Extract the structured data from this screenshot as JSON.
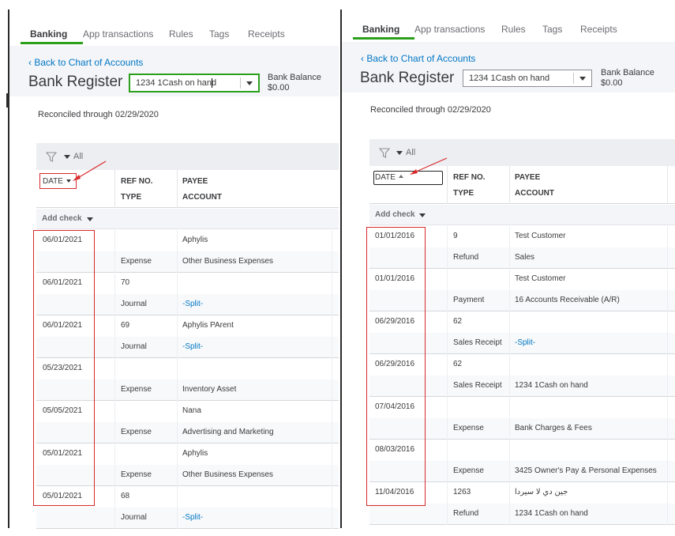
{
  "left": {
    "tabs": [
      "Banking",
      "App transactions",
      "Rules",
      "Tags",
      "Receipts"
    ],
    "back_link": "Back to Chart of Accounts",
    "title": "Bank Register",
    "account": "1234 1Cash on hand",
    "balance_label": "Bank Balance",
    "balance_value": "$0.00",
    "reconciled": "Reconciled through 02/29/2020",
    "filter_all": "All",
    "headers": {
      "date": "DATE",
      "ref": "REF NO.",
      "type": "TYPE",
      "payee": "PAYEE",
      "account": "ACCOUNT"
    },
    "add_check": "Add check",
    "rows": [
      {
        "date": "06/01/2021",
        "ref": "",
        "type": "Expense",
        "payee": "Aphylis",
        "account": "Other Business Expenses"
      },
      {
        "date": "06/01/2021",
        "ref": "70",
        "type": "Journal",
        "payee": "",
        "account": "-Split-"
      },
      {
        "date": "06/01/2021",
        "ref": "69",
        "type": "Journal",
        "payee": "Aphylis PArent",
        "account": "-Split-"
      },
      {
        "date": "05/23/2021",
        "ref": "",
        "type": "Expense",
        "payee": "",
        "account": "Inventory Asset"
      },
      {
        "date": "05/05/2021",
        "ref": "",
        "type": "Expense",
        "payee": "Nana",
        "account": "Advertising and Marketing"
      },
      {
        "date": "05/01/2021",
        "ref": "",
        "type": "Expense",
        "payee": "Aphylis",
        "account": "Other Business Expenses"
      },
      {
        "date": "05/01/2021",
        "ref": "68",
        "type": "Journal",
        "payee": "",
        "account": "-Split-"
      }
    ]
  },
  "right": {
    "tabs": [
      "Banking",
      "App transactions",
      "Rules",
      "Tags",
      "Receipts"
    ],
    "back_link": "Back to Chart of Accounts",
    "title": "Bank Register",
    "account": "1234 1Cash on hand",
    "balance_label": "Bank Balance",
    "balance_value": "$0.00",
    "reconciled": "Reconciled through 02/29/2020",
    "filter_all": "All",
    "headers": {
      "date": "DATE",
      "ref": "REF NO.",
      "type": "TYPE",
      "payee": "PAYEE",
      "account": "ACCOUNT"
    },
    "add_check": "Add check",
    "rows": [
      {
        "date": "01/01/2016",
        "ref": "9",
        "type": "Refund",
        "payee": "Test Customer",
        "account": "Sales"
      },
      {
        "date": "01/01/2016",
        "ref": "",
        "type": "Payment",
        "payee": "Test Customer",
        "account": "16 Accounts Receivable (A/R)"
      },
      {
        "date": "06/29/2016",
        "ref": "62",
        "type": "Sales Receipt",
        "payee": "",
        "account": "-Split-"
      },
      {
        "date": "06/29/2016",
        "ref": "62",
        "type": "Sales Receipt",
        "payee": "",
        "account": "1234 1Cash on hand"
      },
      {
        "date": "07/04/2016",
        "ref": "",
        "type": "Expense",
        "payee": "",
        "account": "Bank Charges & Fees"
      },
      {
        "date": "08/03/2016",
        "ref": "",
        "type": "Expense",
        "payee": "",
        "account": "3425 Owner's Pay & Personal Expenses"
      },
      {
        "date": "11/04/2016",
        "ref": "1263",
        "type": "Refund",
        "payee": "جين دي لا سيردا",
        "account": "1234 1Cash on hand"
      }
    ]
  },
  "colors": {
    "accent_green": "#2ca01c",
    "link_blue": "#0077c5",
    "annotation_red": "#d9292b"
  }
}
